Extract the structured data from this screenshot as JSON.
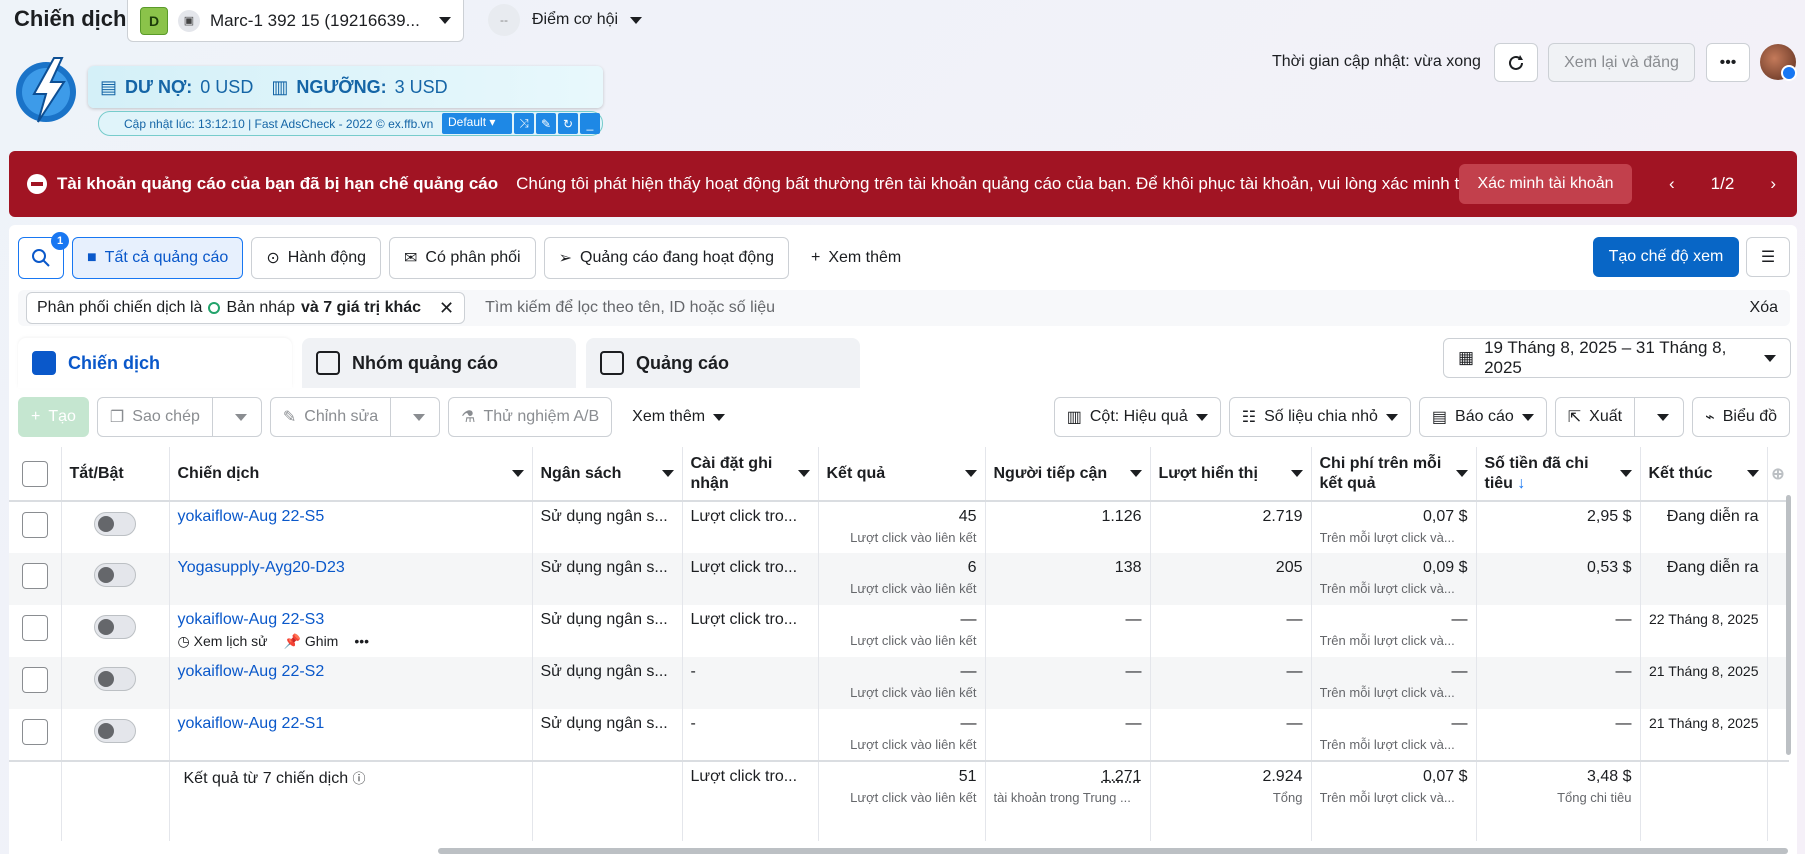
{
  "header": {
    "title": "Chiến dịch",
    "account_badge": "D",
    "account_name": "Marc-1 392 15 (19216639...",
    "opportunity_score_value": "--",
    "opportunity_label": "Điểm cơ hội",
    "update_time": "Thời gian cập nhật: vừa xong",
    "review_button": "Xem lại và đăng"
  },
  "extension": {
    "debt_label": "DƯ NỢ:",
    "debt_value": "0 USD",
    "threshold_label": "NGƯỠNG:",
    "threshold_value": "3 USD",
    "update_line": "Cập nhật lúc: 13:12:10 | Fast AdsCheck - 2022 © ex.ffb.vn",
    "preset": "Default"
  },
  "alert": {
    "title": "Tài khoản quảng cáo của bạn đã bị hạn chế quảng cáo",
    "message": "Chúng tôi phát hiện thấy hoạt động bất thường trên tài khoản quảng cáo của bạn. Để khôi phục tài khoản, vui lòng xác minh thông tin tài ...",
    "button": "Xác minh tài khoản",
    "pager": "1/2"
  },
  "filters": {
    "search_badge": "1",
    "chips": [
      "Tất cả quảng cáo",
      "Hành động",
      "Có phân phối",
      "Quảng cáo đang hoạt động"
    ],
    "more": "Xem thêm",
    "create_view": "Tạo chế độ xem",
    "active_filter_prefix": "Phân phối chiến dịch là",
    "active_filter_value": "Bản nháp",
    "active_filter_suffix": "và 7 giá trị khác",
    "search_placeholder": "Tìm kiếm để lọc theo tên, ID hoặc số liệu",
    "clear": "Xóa"
  },
  "tabs": [
    "Chiến dịch",
    "Nhóm quảng cáo",
    "Quảng cáo"
  ],
  "date_range": "19 Tháng 8, 2025 – 31 Tháng 8, 2025",
  "toolbar": {
    "create": "Tạo",
    "duplicate": "Sao chép",
    "edit": "Chỉnh sửa",
    "ab_test": "Thử nghiệm A/B",
    "more": "Xem thêm",
    "columns": "Cột: Hiệu quả",
    "breakdown": "Số liệu chia nhỏ",
    "reports": "Báo cáo",
    "export": "Xuất",
    "charts": "Biểu đồ"
  },
  "table": {
    "headers": [
      "Tắt/Bật",
      "Chiến dịch",
      "Ngân sách",
      "Cài đặt ghi nhận",
      "Kết quả",
      "Người tiếp cận",
      "Lượt hiển thị",
      "Chi phí trên mỗi kết quả",
      "Số tiền đã chi tiêu",
      "Kết thúc"
    ],
    "row_actions": {
      "history": "Xem lịch sử",
      "pin": "Ghim"
    },
    "rows": [
      {
        "name": "yokaiflow-Aug 22-S5",
        "budget": "Sử dụng ngân s...",
        "attribution": "Lượt click tro...",
        "results": "45",
        "results_sub": "Lượt click vào liên kết",
        "reach": "1.126",
        "impressions": "2.719",
        "cpr": "0,07 $",
        "cpr_sub": "Trên mỗi lượt click và...",
        "spent": "2,95 $",
        "end": "Đang diễn ra"
      },
      {
        "name": "Yogasupply-Ayg20-D23",
        "budget": "Sử dụng ngân s...",
        "attribution": "Lượt click tro...",
        "results": "6",
        "results_sub": "Lượt click vào liên kết",
        "reach": "138",
        "impressions": "205",
        "cpr": "0,09 $",
        "cpr_sub": "Trên mỗi lượt click và...",
        "spent": "0,53 $",
        "end": "Đang diễn ra"
      },
      {
        "name": "yokaiflow-Aug 22-S3",
        "budget": "Sử dụng ngân s...",
        "attribution": "Lượt click tro...",
        "results": "—",
        "results_sub": "Lượt click vào liên kết",
        "reach": "—",
        "impressions": "—",
        "cpr": "—",
        "cpr_sub": "Trên mỗi lượt click và...",
        "spent": "—",
        "end": "22 Tháng 8, 2025"
      },
      {
        "name": "yokaiflow-Aug 22-S2",
        "budget": "Sử dụng ngân s...",
        "attribution": "-",
        "results": "—",
        "results_sub": "Lượt click vào liên kết",
        "reach": "—",
        "impressions": "—",
        "cpr": "—",
        "cpr_sub": "Trên mỗi lượt click và...",
        "spent": "—",
        "end": "21 Tháng 8, 2025"
      },
      {
        "name": "yokaiflow-Aug 22-S1",
        "budget": "Sử dụng ngân s...",
        "attribution": "-",
        "results": "—",
        "results_sub": "Lượt click vào liên kết",
        "reach": "—",
        "impressions": "—",
        "cpr": "—",
        "cpr_sub": "Trên mỗi lượt click và...",
        "spent": "—",
        "end": "21 Tháng 8, 2025"
      }
    ],
    "total": {
      "label": "Kết quả từ 7 chiến dịch",
      "attribution": "Lượt click tro...",
      "results": "51",
      "results_sub": "Lượt click vào liên kết",
      "reach": "1.271",
      "reach_sub": "tài khoản trong Trung ...",
      "impressions": "2.924",
      "impressions_sub": "Tổng",
      "cpr": "0,07 $",
      "cpr_sub": "Trên mỗi lượt click và...",
      "spent": "3,48 $",
      "spent_sub": "Tổng chi tiêu"
    }
  }
}
